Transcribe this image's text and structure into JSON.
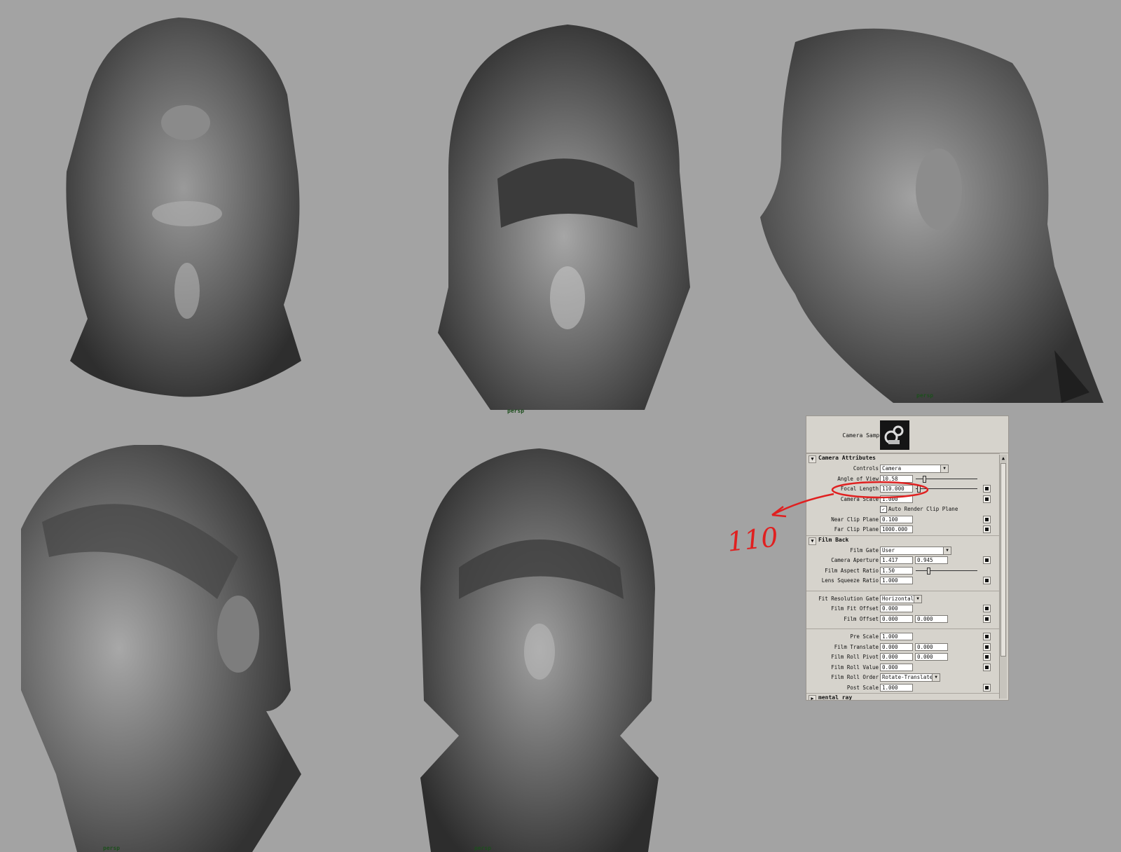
{
  "viewports": [
    {
      "label": "",
      "view": "from-below"
    },
    {
      "label": "persp",
      "view": "front-high"
    },
    {
      "label": "persp",
      "view": "side"
    },
    {
      "label": "persp",
      "view": "three-quarter"
    },
    {
      "label": "persp",
      "view": "front"
    }
  ],
  "panel": {
    "node_name": "Camera Sample",
    "sections": {
      "camera_attributes": "Camera Attributes",
      "film_back": "Film Back",
      "mental_ray": "mental ray"
    },
    "controls": {
      "label": "Controls",
      "value": "Camera"
    },
    "angle_of_view": {
      "label": "Angle of View",
      "value": "10.58"
    },
    "focal_length": {
      "label": "Focal Length",
      "value": "110.000"
    },
    "camera_scale": {
      "label": "Camera Scale",
      "value": "1.000"
    },
    "auto_render_clip": {
      "label": "Auto Render Clip Plane",
      "checked": "✓"
    },
    "near_clip": {
      "label": "Near Clip Plane",
      "value": "0.100"
    },
    "far_clip": {
      "label": "Far Clip Plane",
      "value": "1000.000"
    },
    "film_gate": {
      "label": "Film Gate",
      "value": "User"
    },
    "camera_aperture": {
      "label": "Camera Aperture",
      "value1": "1.417",
      "value2": "0.945"
    },
    "film_aspect_ratio": {
      "label": "Film Aspect Ratio",
      "value": "1.50"
    },
    "lens_squeeze_ratio": {
      "label": "Lens Squeeze Ratio",
      "value": "1.000"
    },
    "fit_resolution_gate": {
      "label": "Fit Resolution Gate",
      "value": "Horizontal"
    },
    "film_fit_offset": {
      "label": "Film Fit Offset",
      "value": "0.000"
    },
    "film_offset": {
      "label": "Film Offset",
      "value1": "0.000",
      "value2": "0.000"
    },
    "pre_scale": {
      "label": "Pre Scale",
      "value": "1.000"
    },
    "film_translate": {
      "label": "Film Translate",
      "value1": "0.000",
      "value2": "0.000"
    },
    "film_roll_pivot": {
      "label": "Film Roll Pivot",
      "value1": "0.000",
      "value2": "0.000"
    },
    "film_roll_value": {
      "label": "Film Roll Value",
      "value": "0.000"
    },
    "film_roll_order": {
      "label": "Film Roll Order",
      "value": "Rotate-Translate"
    },
    "post_scale": {
      "label": "Post Scale",
      "value": "1.000"
    }
  },
  "annotation": {
    "text": "110",
    "color": "#e02020"
  }
}
